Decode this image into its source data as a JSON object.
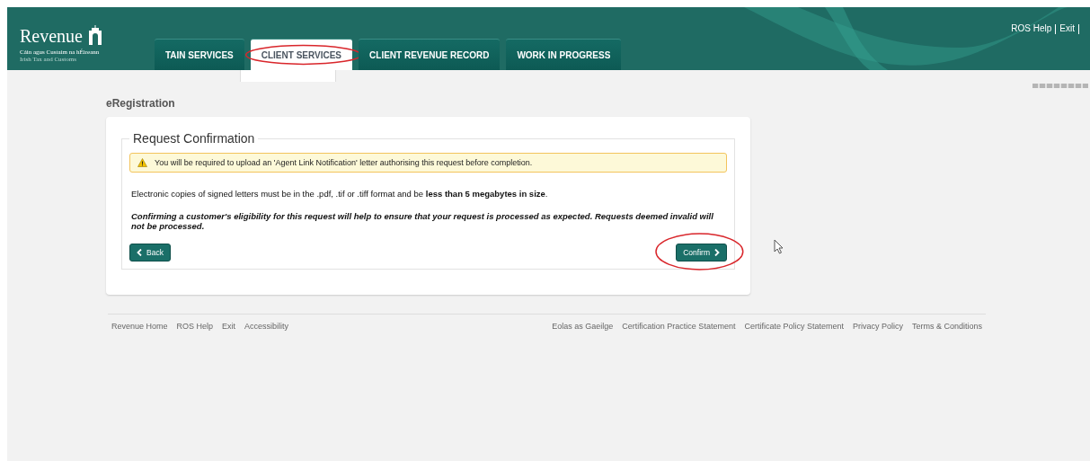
{
  "header": {
    "logo": {
      "name": "Revenue",
      "subtitle_irish": "Cáin agus Custaim na hÉireann",
      "subtitle_english": "Irish Tax and Customs"
    },
    "tabs": [
      {
        "label": "TAIN SERVICES",
        "selected": false,
        "circled": false
      },
      {
        "label": "CLIENT SERVICES",
        "selected": true,
        "circled": true
      },
      {
        "label": "CLIENT REVENUE RECORD",
        "selected": false,
        "circled": false
      },
      {
        "label": "WORK IN PROGRESS",
        "selected": false,
        "circled": false
      }
    ],
    "top_links": [
      "ROS Help",
      "Exit"
    ]
  },
  "page_title": "eRegistration",
  "panel": {
    "legend": "Request Confirmation",
    "warning": "You will be required to upload an 'Agent Link Notification' letter authorising this request before completion.",
    "info": "Electronic copies of signed letters must be in the .pdf, .tif or .tiff format and be **less than 5 megabytes in size**.",
    "notice": "Confirming a customer's eligibility for this request will help to ensure that your request is processed as expected. Requests deemed invalid will not be processed.",
    "back_button": "Back",
    "confirm_button": {
      "label": "Confirm",
      "circled": true
    }
  },
  "footer": {
    "left_links": [
      "Revenue Home",
      "ROS Help",
      "Exit",
      "Accessibility"
    ],
    "right_links": [
      "Eolas as Gaeilge",
      "Certification Practice Statement",
      "Certificate Policy Statement",
      "Privacy Policy",
      "Terms & Conditions"
    ]
  }
}
